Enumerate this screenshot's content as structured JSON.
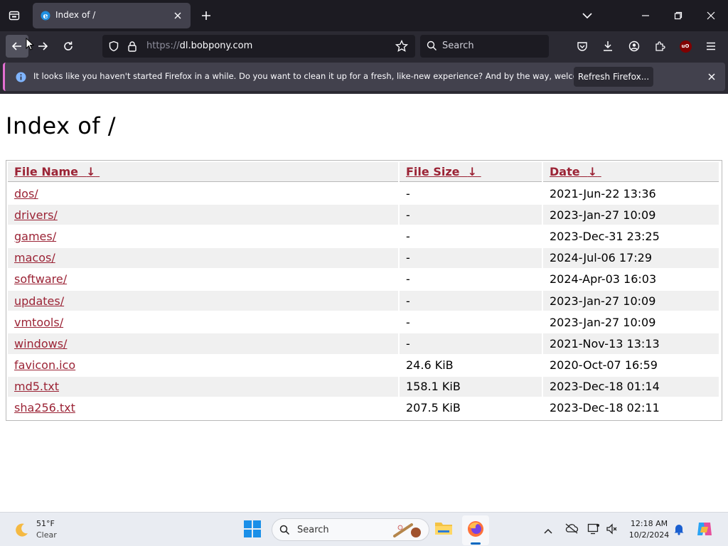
{
  "browser": {
    "tab_title": "Index of /",
    "url_scheme": "https://",
    "url_host": "dl.bobpony.com",
    "search_placeholder": "Search",
    "ublock_badge": "uO"
  },
  "notification": {
    "message": "It looks like you haven't started Firefox in a while. Do you want to clean it up for a fresh, like-new experience? And by the way, welcome back!",
    "button_label": "Refresh Firefox..."
  },
  "page": {
    "heading": "Index of /",
    "columns": {
      "name": "File Name",
      "size": "File Size",
      "date": "Date",
      "sort_arrow": "↓"
    },
    "rows": [
      {
        "name": "dos/",
        "size": "-",
        "date": "2021-Jun-22 13:36"
      },
      {
        "name": "drivers/",
        "size": "-",
        "date": "2023-Jan-27 10:09"
      },
      {
        "name": "games/",
        "size": "-",
        "date": "2023-Dec-31 23:25"
      },
      {
        "name": "macos/",
        "size": "-",
        "date": "2024-Jul-06 17:29"
      },
      {
        "name": "software/",
        "size": "-",
        "date": "2024-Apr-03 16:03"
      },
      {
        "name": "updates/",
        "size": "-",
        "date": "2023-Jan-27 10:09"
      },
      {
        "name": "vmtools/",
        "size": "-",
        "date": "2023-Jan-27 10:09"
      },
      {
        "name": "windows/",
        "size": "-",
        "date": "2021-Nov-13 13:13"
      },
      {
        "name": "favicon.ico",
        "size": "24.6 KiB",
        "date": "2020-Oct-07 16:59"
      },
      {
        "name": "md5.txt",
        "size": "158.1 KiB",
        "date": "2023-Dec-18 01:14"
      },
      {
        "name": "sha256.txt",
        "size": "207.5 KiB",
        "date": "2023-Dec-18 02:11"
      }
    ]
  },
  "taskbar": {
    "weather_temp": "51°F",
    "weather_desc": "Clear",
    "search_placeholder": "Search",
    "time": "12:18 AM",
    "date": "10/2/2024"
  },
  "colors": {
    "link": "#9b2335",
    "chrome_dark": "#1c1b22",
    "chrome_mid": "#2b2a33",
    "accent_notification": "#e36fd1"
  }
}
